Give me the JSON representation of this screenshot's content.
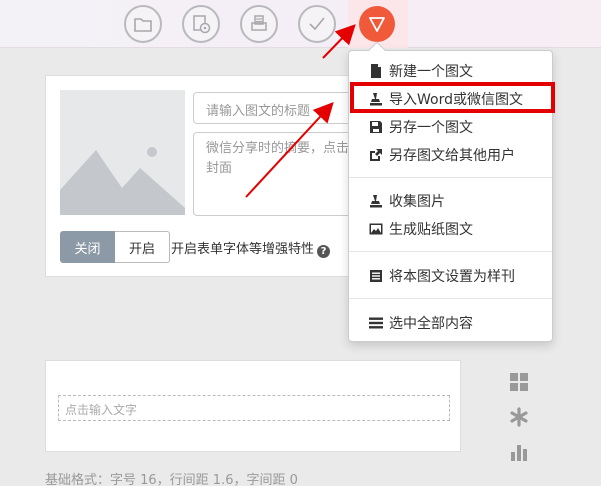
{
  "toolbar": {
    "buttons": [
      {
        "icon": "folder-icon"
      },
      {
        "icon": "import-disc-icon"
      },
      {
        "icon": "print-icon"
      },
      {
        "icon": "checkmark-icon"
      },
      {
        "icon": "triangle-down-icon",
        "active": true
      }
    ]
  },
  "editor": {
    "title_placeholder": "请输入图文的标题",
    "abstract_placeholder": "微信分享时的摘要，点击封面",
    "toggle_off": "关闭",
    "toggle_on": "开启",
    "toggle_selected": "关闭",
    "enhance_label": "开启表单字体等增强特性",
    "text_placeholder": "点击输入文字",
    "base_format": "基础格式：字号 16，行间距 1.6，字间距 0"
  },
  "menu": {
    "items": [
      {
        "label": "新建一个图文",
        "icon": "file-icon"
      },
      {
        "label": "导入Word或微信图文",
        "icon": "stamp-icon",
        "highlighted": true
      },
      {
        "label": "另存一个图文",
        "icon": "save-as-icon"
      },
      {
        "label": "另存图文给其他用户",
        "icon": "share-icon"
      },
      {
        "label": "收集图片",
        "icon": "stamp-icon"
      },
      {
        "label": "生成贴纸图文",
        "icon": "image-icon"
      },
      {
        "label": "将本图文设置为样刊",
        "icon": "list-icon"
      },
      {
        "label": "选中全部内容",
        "icon": "menu-lines-icon"
      }
    ]
  },
  "colors": {
    "accent": "#f05a3a",
    "highlight_box": "#e50000",
    "toggle_off_bg": "#8c99a6"
  }
}
